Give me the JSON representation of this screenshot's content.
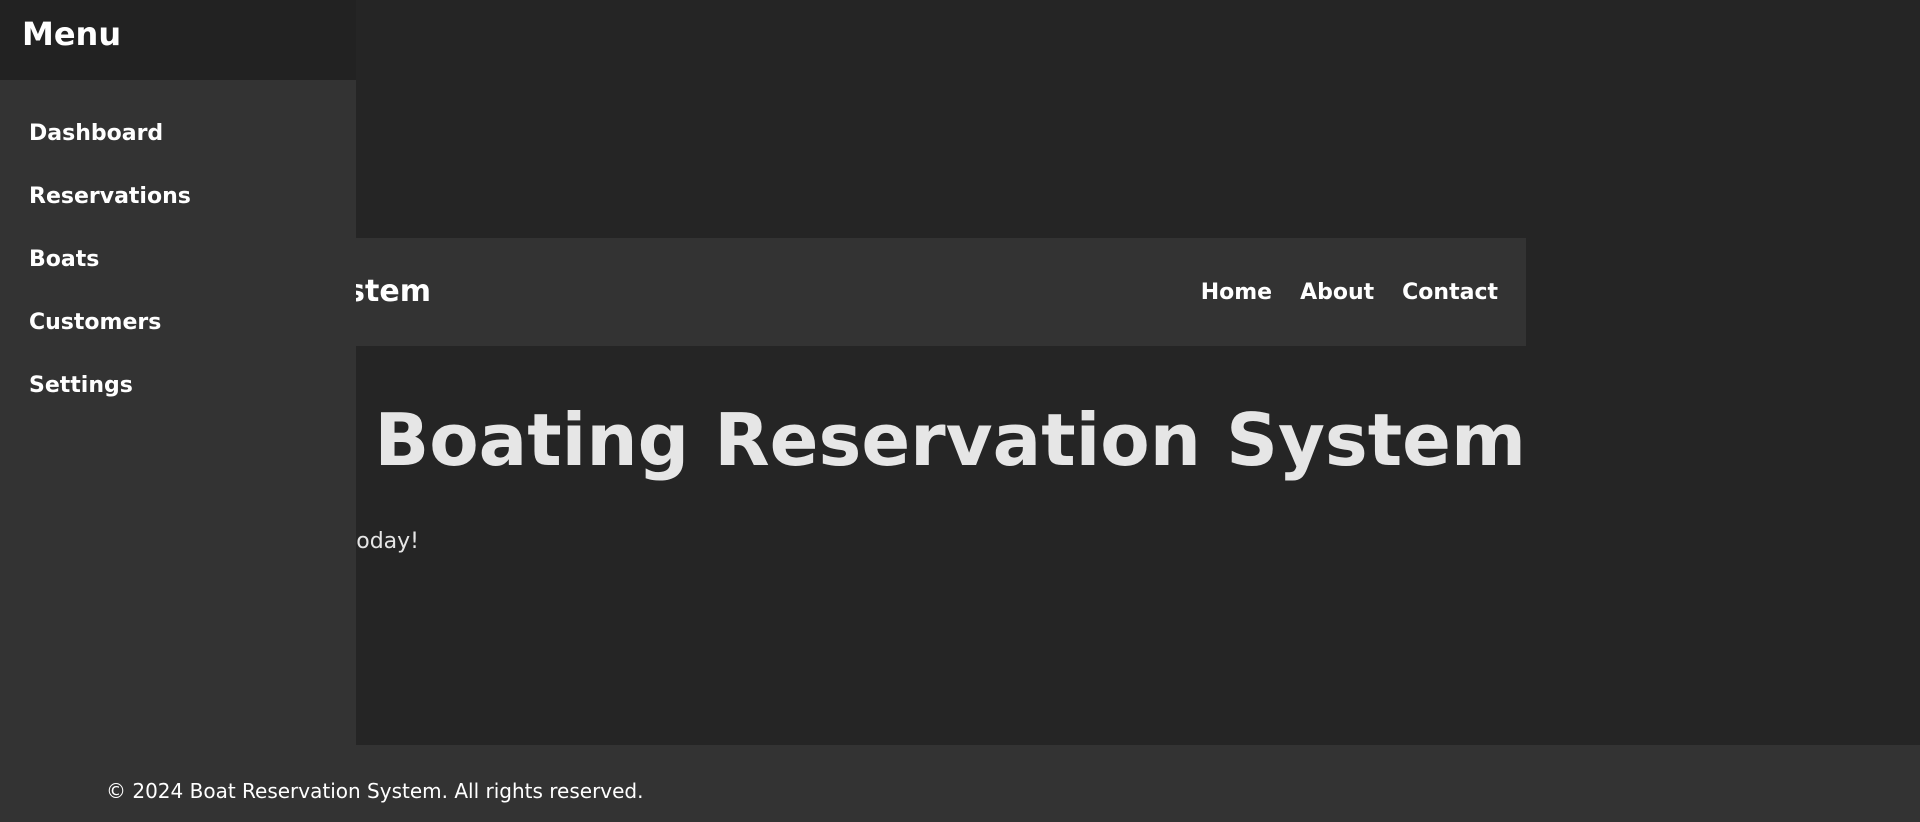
{
  "header": {
    "title": "Boat Reservation System",
    "nav": [
      "Home",
      "About",
      "Contact"
    ]
  },
  "hero": {
    "title": "Welcome to our Boating Reservation System",
    "subtitle": "Book your boat today!"
  },
  "sidebar": {
    "title": "Menu",
    "items": [
      "Dashboard",
      "Reservations",
      "Boats",
      "Customers",
      "Settings"
    ]
  },
  "footer": {
    "text": "© 2024 Boat Reservation System. All rights reserved."
  },
  "colors": {
    "background": "#252525",
    "panel": "#333333",
    "sidebar_header": "#222222",
    "text": "#ffffff"
  }
}
